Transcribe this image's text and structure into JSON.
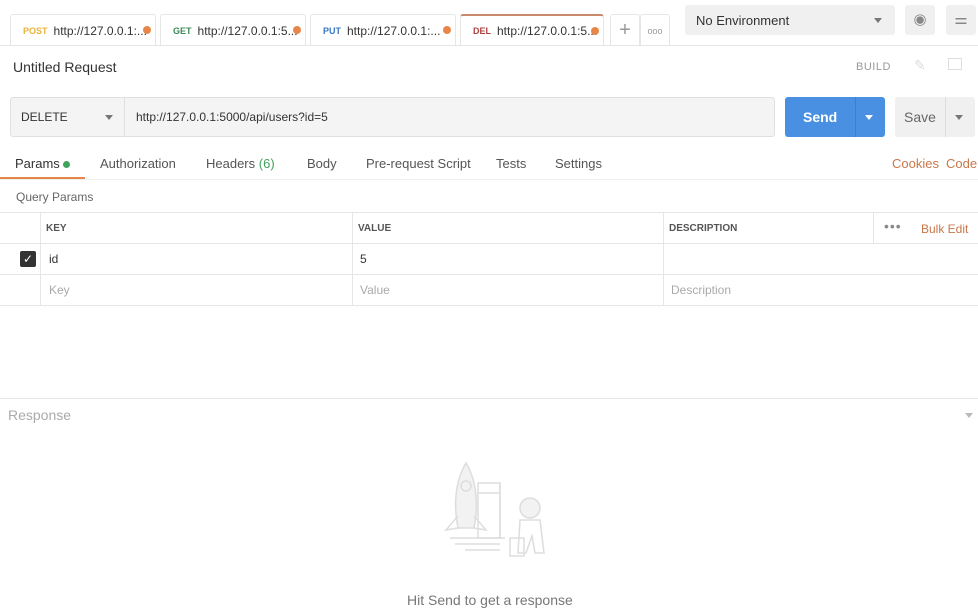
{
  "tabs": [
    {
      "method": "POST",
      "url": "http://127.0.0.1:...",
      "color": "#e8b23a"
    },
    {
      "method": "GET",
      "url": "http://127.0.0.1:5...",
      "color": "#3f8a5a"
    },
    {
      "method": "PUT",
      "url": "http://127.0.0.1:...",
      "color": "#3a78c2"
    },
    {
      "method": "DEL",
      "url": "http://127.0.0.1:5...",
      "color": "#b0413e"
    }
  ],
  "environment": "No Environment",
  "request_title": "Untitled Request",
  "build_label": "BUILD",
  "method": "DELETE",
  "url": "http://127.0.0.1:5000/api/users?id=5",
  "send_label": "Send",
  "save_label": "Save",
  "request_tabs": [
    "Params",
    "Authorization",
    "Headers",
    "(6)",
    "Body",
    "Pre-request Script",
    "Tests",
    "Settings"
  ],
  "cookies_label": "Cookies",
  "code_label": "Code",
  "query_params_label": "Query Params",
  "columns": {
    "key": "KEY",
    "value": "VALUE",
    "description": "DESCRIPTION"
  },
  "bulk_edit": "Bulk Edit",
  "rows": [
    {
      "key": "id",
      "value": "5",
      "checked": true
    }
  ],
  "placeholders": {
    "key": "Key",
    "value": "Value",
    "description": "Description"
  },
  "response_label": "Response",
  "empty_message": "Hit Send to get a response",
  "accent": "#4a90e2"
}
